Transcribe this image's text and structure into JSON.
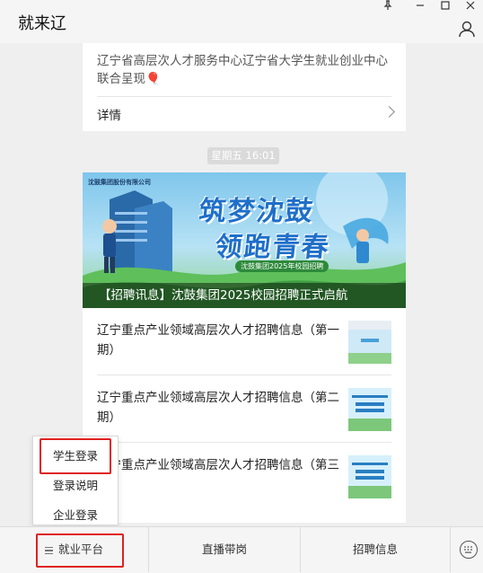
{
  "window": {
    "title": "就来辽",
    "controls": [
      "pin-icon",
      "minimize-icon",
      "maximize-icon",
      "close-icon"
    ]
  },
  "messages": {
    "card1": {
      "text": "辽宁省高层次人才服务中心辽宁省大学生就业创业中心联合呈现🎈",
      "link_label": "详情"
    },
    "timestamp": "星期五 16:01",
    "article": {
      "banner_caption": "【招聘讯息】沈鼓集团2025校园招聘正式启航",
      "banner_brand": "沈鼓集团股份有限公司",
      "banner_title_line1": "筑梦沈鼓",
      "banner_title_line2": "领跑青春",
      "banner_subtitle": "沈鼓集团2025年校园招聘",
      "items": [
        {
          "title": "辽宁重点产业领域高层次人才招聘信息（第一期）",
          "thumb_text": ""
        },
        {
          "title": "辽宁重点产业领域高层次人才招聘信息（第二期）",
          "thumb_text": "辽宁重点产业领域高层次人才招聘信息"
        },
        {
          "title": "辽宁重点产业领域高层次人才招聘信息（第三期）",
          "thumb_text": "辽宁重点产业领域高层次人才招聘信息"
        }
      ]
    }
  },
  "popup_menu": {
    "items": [
      "学生登录",
      "登录说明",
      "企业登录"
    ]
  },
  "bottom_menu": {
    "tabs": [
      "就业平台",
      "直播带岗",
      "招聘信息"
    ],
    "keyboard_icon": "keyboard-icon"
  },
  "colors": {
    "highlight": "#e02020",
    "title_blue": "#1f6fc9"
  }
}
